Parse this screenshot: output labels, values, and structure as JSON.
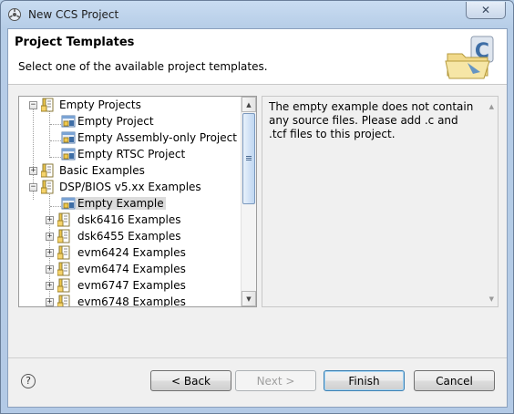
{
  "window": {
    "title": "New CCS Project",
    "close_glyph": "✕"
  },
  "banner": {
    "title": "Project Templates",
    "description": "Select one of the available project templates.",
    "image_icon": "folder-with-c-icon"
  },
  "tree": {
    "items": [
      {
        "label": "Empty Projects",
        "expander": "−",
        "icon": "folder-icon"
      },
      {
        "label": "Empty Project",
        "icon": "project-template-icon"
      },
      {
        "label": "Empty Assembly-only Project",
        "icon": "project-template-icon"
      },
      {
        "label": "Empty RTSC Project",
        "icon": "project-template-icon"
      },
      {
        "label": "Basic Examples",
        "expander": "+",
        "icon": "folder-icon"
      },
      {
        "label": "DSP/BIOS v5.xx Examples",
        "expander": "−",
        "icon": "folder-icon"
      },
      {
        "label": "Empty Example",
        "icon": "project-template-icon",
        "selected": true
      },
      {
        "label": "dsk6416 Examples",
        "expander": "+",
        "icon": "folder-icon"
      },
      {
        "label": "dsk6455 Examples",
        "expander": "+",
        "icon": "folder-icon"
      },
      {
        "label": "evm6424 Examples",
        "expander": "+",
        "icon": "folder-icon"
      },
      {
        "label": "evm6474 Examples",
        "expander": "+",
        "icon": "folder-icon"
      },
      {
        "label": "evm6747 Examples",
        "expander": "+",
        "icon": "folder-icon"
      },
      {
        "label": "evm6748 Examples",
        "expander": "+",
        "icon": "folder-icon"
      }
    ]
  },
  "description_panel": {
    "text": "The empty example does not contain any source files. Please add .c and .tcf files to this project."
  },
  "buttons": {
    "help": "?",
    "back": "< Back",
    "next": "Next >",
    "finish": "Finish",
    "cancel": "Cancel"
  },
  "scrollbar": {
    "up": "▲",
    "down": "▼"
  }
}
